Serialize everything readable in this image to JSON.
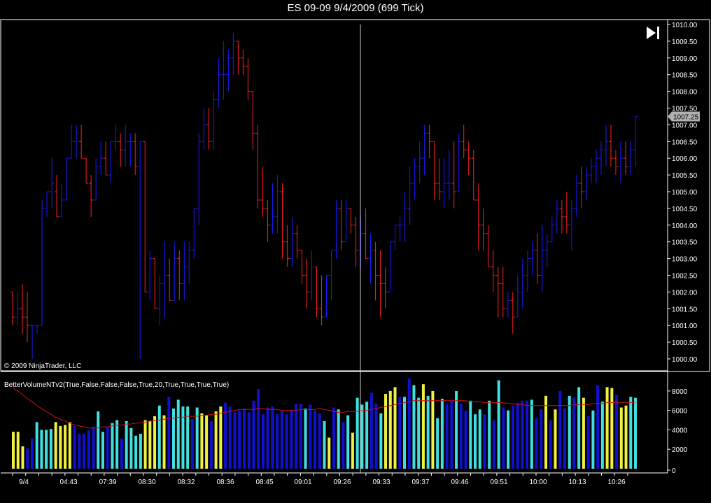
{
  "window": {
    "title": "ES 09-09  9/4/2009 (699 Tick)"
  },
  "price_panel": {
    "copyright": "© 2009 NinjaTrader, LLC",
    "last_price_label": "1007.25",
    "y_ticks": [
      "1010.00",
      "1009.50",
      "1009.00",
      "1008.50",
      "1008.00",
      "1007.50",
      "1007.00",
      "1006.50",
      "1006.00",
      "1005.50",
      "1005.00",
      "1004.50",
      "1004.00",
      "1003.50",
      "1003.00",
      "1002.50",
      "1002.00",
      "1001.50",
      "1001.00",
      "1000.50",
      "1000.00"
    ]
  },
  "volume_panel": {
    "indicator_label": "BetterVolumeNTv2(True,False,False,False,True,20,True,True,True,True)",
    "y_ticks": [
      "8000",
      "6000",
      "4000",
      "2000",
      "0"
    ]
  },
  "x_ticks": [
    "9/4",
    "04:43",
    "07:39",
    "08:30",
    "08:32",
    "08:36",
    "08:45",
    "09:01",
    "09:26",
    "09:33",
    "09:37",
    "09:46",
    "09:51",
    "10:00",
    "10:13",
    "10:26"
  ],
  "colors": {
    "up_bar": "#1a1aff",
    "down_bar": "#ff2020",
    "vol_blue": "#1010d0",
    "vol_cyan": "#40e0e0",
    "vol_yellow": "#f0f040",
    "avg_line": "#cc1111",
    "crosshair": "#cccccc",
    "last_price_bg": "#b0b0b0"
  },
  "chart_data": [
    {
      "type": "ohlc",
      "ylim": [
        999.8,
        1010.1
      ],
      "bars": [
        [
          1002.0,
          1002.0,
          1001.0,
          1001.25
        ],
        [
          1001.25,
          1002.0,
          1001.0,
          1001.5
        ],
        [
          1001.5,
          1002.25,
          1000.75,
          1001.25
        ],
        [
          1001.25,
          1002.0,
          1000.5,
          1001.0
        ],
        [
          1001.0,
          1001.0,
          1000.0,
          1001.0
        ],
        [
          1001.0,
          1001.0,
          1000.75,
          1001.0
        ],
        [
          1001.0,
          1004.75,
          1001.0,
          1004.5
        ],
        [
          1004.5,
          1005.0,
          1004.25,
          1005.0
        ],
        [
          1005.0,
          1006.0,
          1004.5,
          1005.25
        ],
        [
          1005.0,
          1005.5,
          1004.25,
          1004.25
        ],
        [
          1004.25,
          1005.25,
          1004.25,
          1004.75
        ],
        [
          1004.75,
          1006.0,
          1004.75,
          1006.0
        ],
        [
          1006.0,
          1007.0,
          1006.0,
          1006.5
        ],
        [
          1006.5,
          1007.0,
          1006.0,
          1006.75
        ],
        [
          1006.5,
          1007.0,
          1006.0,
          1006.0
        ],
        [
          1006.0,
          1006.0,
          1005.25,
          1005.25
        ],
        [
          1005.25,
          1005.5,
          1004.25,
          1004.75
        ],
        [
          1004.75,
          1006.0,
          1004.75,
          1005.75
        ],
        [
          1005.75,
          1006.5,
          1005.5,
          1006.0
        ],
        [
          1006.0,
          1006.5,
          1005.5,
          1005.5
        ],
        [
          1005.5,
          1006.5,
          1005.25,
          1006.5
        ],
        [
          1006.5,
          1007.0,
          1006.25,
          1006.5
        ],
        [
          1006.5,
          1006.75,
          1005.75,
          1006.25
        ],
        [
          1006.25,
          1007.0,
          1005.75,
          1006.5
        ],
        [
          1006.5,
          1006.75,
          1005.75,
          1006.5
        ],
        [
          1006.5,
          1006.75,
          1005.5,
          1005.75
        ],
        [
          1005.75,
          1006.5,
          1000.0,
          1006.5
        ],
        [
          1006.5,
          1006.5,
          1002.0,
          1002.0
        ],
        [
          1002.0,
          1003.25,
          1001.75,
          1003.0
        ],
        [
          1003.0,
          1003.0,
          1001.5,
          1001.5
        ],
        [
          1001.5,
          1002.5,
          1001.0,
          1002.25
        ],
        [
          1002.25,
          1003.5,
          1001.25,
          1002.5
        ],
        [
          1002.5,
          1003.0,
          1001.75,
          1001.75
        ],
        [
          1001.75,
          1003.5,
          1001.75,
          1003.0
        ],
        [
          1003.0,
          1003.25,
          1001.75,
          1002.25
        ],
        [
          1002.25,
          1003.5,
          1001.75,
          1002.75
        ],
        [
          1002.75,
          1003.5,
          1002.25,
          1003.25
        ],
        [
          1003.25,
          1004.5,
          1003.0,
          1004.5
        ],
        [
          1004.5,
          1006.75,
          1004.0,
          1006.5
        ],
        [
          1006.5,
          1007.5,
          1006.25,
          1007.0
        ],
        [
          1007.0,
          1007.5,
          1006.25,
          1006.5
        ],
        [
          1006.5,
          1008.0,
          1006.25,
          1007.75
        ],
        [
          1007.75,
          1009.0,
          1007.5,
          1008.5
        ],
        [
          1008.5,
          1009.5,
          1007.75,
          1008.5
        ],
        [
          1008.5,
          1009.25,
          1008.0,
          1009.0
        ],
        [
          1009.0,
          1009.75,
          1008.5,
          1009.5
        ],
        [
          1009.5,
          1009.5,
          1008.5,
          1009.0
        ],
        [
          1009.0,
          1009.25,
          1008.5,
          1008.75
        ],
        [
          1008.75,
          1009.0,
          1007.75,
          1008.0
        ],
        [
          1008.0,
          1008.0,
          1006.25,
          1006.75
        ],
        [
          1006.75,
          1007.0,
          1004.5,
          1004.75
        ],
        [
          1004.75,
          1005.75,
          1004.25,
          1004.5
        ],
        [
          1004.5,
          1004.75,
          1003.5,
          1004.0
        ],
        [
          1004.0,
          1005.25,
          1003.75,
          1004.25
        ],
        [
          1004.25,
          1005.5,
          1003.75,
          1005.0
        ],
        [
          1005.0,
          1005.25,
          1003.0,
          1003.5
        ],
        [
          1003.5,
          1004.0,
          1002.75,
          1003.0
        ],
        [
          1003.0,
          1004.25,
          1002.75,
          1003.75
        ],
        [
          1003.75,
          1004.0,
          1003.0,
          1003.25
        ],
        [
          1003.25,
          1003.25,
          1002.25,
          1002.5
        ],
        [
          1002.5,
          1003.0,
          1001.5,
          1002.0
        ],
        [
          1002.0,
          1003.25,
          1001.75,
          1002.75
        ],
        [
          1002.75,
          1002.75,
          1001.25,
          1001.5
        ],
        [
          1001.5,
          1002.5,
          1001.0,
          1001.25
        ],
        [
          1001.25,
          1002.5,
          1001.25,
          1002.5
        ],
        [
          1002.5,
          1003.25,
          1001.75,
          1003.25
        ],
        [
          1003.25,
          1004.75,
          1003.0,
          1004.5
        ],
        [
          1004.5,
          1004.75,
          1003.25,
          1003.5
        ],
        [
          1003.5,
          1004.75,
          1003.5,
          1004.5
        ],
        [
          1004.5,
          1004.5,
          1003.75,
          1004.0
        ],
        [
          1004.0,
          1004.25,
          1002.75,
          1003.25
        ],
        [
          1003.25,
          1004.25,
          1002.75,
          1003.75
        ],
        [
          1003.75,
          1004.5,
          1003.0,
          1003.0
        ],
        [
          1003.0,
          1003.75,
          1002.25,
          1003.25
        ],
        [
          1003.25,
          1003.5,
          1001.75,
          1002.5
        ],
        [
          1002.5,
          1003.25,
          1001.25,
          1002.25
        ],
        [
          1002.25,
          1002.75,
          1001.5,
          1002.0
        ],
        [
          1002.0,
          1003.5,
          1002.0,
          1003.5
        ],
        [
          1003.5,
          1004.0,
          1003.25,
          1004.0
        ],
        [
          1004.0,
          1004.25,
          1003.5,
          1004.0
        ],
        [
          1004.0,
          1005.0,
          1003.5,
          1004.5
        ],
        [
          1004.5,
          1005.75,
          1004.0,
          1005.25
        ],
        [
          1005.25,
          1006.0,
          1004.75,
          1005.75
        ],
        [
          1005.75,
          1006.5,
          1005.25,
          1006.0
        ],
        [
          1006.0,
          1007.0,
          1005.5,
          1006.75
        ],
        [
          1006.75,
          1007.0,
          1006.0,
          1006.5
        ],
        [
          1006.5,
          1006.5,
          1004.75,
          1005.25
        ],
        [
          1005.25,
          1006.0,
          1004.75,
          1005.0
        ],
        [
          1005.0,
          1006.0,
          1004.5,
          1005.25
        ],
        [
          1005.25,
          1006.25,
          1004.75,
          1005.25
        ],
        [
          1005.25,
          1006.5,
          1004.5,
          1005.0
        ],
        [
          1005.0,
          1006.75,
          1005.0,
          1006.5
        ],
        [
          1006.5,
          1007.0,
          1006.0,
          1006.25
        ],
        [
          1006.25,
          1006.5,
          1005.5,
          1006.0
        ],
        [
          1006.0,
          1006.25,
          1004.75,
          1004.75
        ],
        [
          1004.75,
          1005.25,
          1003.25,
          1004.0
        ],
        [
          1004.0,
          1004.5,
          1003.25,
          1003.75
        ],
        [
          1003.75,
          1004.0,
          1002.75,
          1002.75
        ],
        [
          1002.75,
          1003.25,
          1002.0,
          1002.5
        ],
        [
          1002.5,
          1002.75,
          1001.25,
          1002.25
        ],
        [
          1002.25,
          1002.75,
          1001.25,
          1001.5
        ],
        [
          1001.5,
          1002.0,
          1001.25,
          1001.75
        ],
        [
          1001.75,
          1002.0,
          1000.75,
          1001.25
        ],
        [
          1001.25,
          1002.5,
          1001.25,
          1002.0
        ],
        [
          1002.0,
          1003.0,
          1001.5,
          1002.5
        ],
        [
          1002.5,
          1003.25,
          1002.0,
          1003.0
        ],
        [
          1003.0,
          1003.5,
          1002.5,
          1003.25
        ],
        [
          1003.25,
          1003.75,
          1002.25,
          1002.5
        ],
        [
          1002.5,
          1004.0,
          1002.0,
          1003.25
        ],
        [
          1003.25,
          1003.75,
          1002.75,
          1003.5
        ],
        [
          1003.5,
          1004.25,
          1003.5,
          1004.0
        ],
        [
          1004.0,
          1004.75,
          1003.75,
          1004.5
        ],
        [
          1004.5,
          1004.75,
          1003.75,
          1004.25
        ],
        [
          1004.25,
          1005.0,
          1003.75,
          1004.0
        ],
        [
          1004.0,
          1004.75,
          1003.25,
          1004.5
        ],
        [
          1004.5,
          1005.5,
          1004.25,
          1005.25
        ],
        [
          1005.25,
          1005.75,
          1004.5,
          1005.0
        ],
        [
          1005.0,
          1005.75,
          1004.75,
          1005.5
        ],
        [
          1005.5,
          1006.0,
          1005.25,
          1005.75
        ],
        [
          1005.75,
          1006.25,
          1005.25,
          1006.0
        ],
        [
          1006.0,
          1006.5,
          1005.5,
          1006.25
        ],
        [
          1006.25,
          1007.0,
          1005.75,
          1006.5
        ],
        [
          1006.5,
          1007.0,
          1005.75,
          1006.0
        ],
        [
          1006.0,
          1006.25,
          1005.5,
          1005.75
        ],
        [
          1005.75,
          1006.5,
          1005.25,
          1006.0
        ],
        [
          1006.0,
          1006.5,
          1005.5,
          1005.75
        ],
        [
          1005.75,
          1006.5,
          1005.5,
          1006.25
        ],
        [
          1006.25,
          1007.25,
          1005.75,
          1007.25
        ]
      ]
    },
    {
      "type": "bar",
      "ylim": [
        0,
        9000
      ],
      "values": [
        3800,
        3800,
        2300,
        2100,
        3100,
        4800,
        4000,
        4000,
        4100,
        4800,
        4400,
        4500,
        4800,
        4400,
        3600,
        3600,
        4000,
        4300,
        5900,
        3800,
        4300,
        4700,
        5000,
        3100,
        4900,
        4200,
        3400,
        3600,
        5000,
        4900,
        5400,
        6500,
        5500,
        7400,
        6200,
        7100,
        6400,
        6400,
        5100,
        6300,
        5700,
        5500,
        4900,
        5900,
        6400,
        6800,
        6400,
        5800,
        6000,
        6200,
        5800,
        7000,
        8200,
        5600,
        6300,
        6400,
        5600,
        6000,
        5600,
        6100,
        6700,
        6700,
        6200,
        6600,
        6000,
        5700,
        4900,
        3200,
        6300,
        6100,
        4800,
        5500,
        3700,
        7300,
        6600,
        6900,
        7800,
        6700,
        5700,
        7700,
        8000,
        8400,
        7400,
        7400,
        9300,
        8600,
        7300,
        8700,
        7500,
        8000,
        5200,
        7200,
        6700,
        7000,
        8000,
        6700,
        6000,
        7000,
        5600,
        6100,
        5600,
        7000,
        5000,
        9100,
        6300,
        6000,
        6500,
        6800,
        7000,
        7000,
        7100,
        5200,
        6100,
        7500,
        5000,
        6100,
        8000,
        6200,
        7500,
        7300,
        8400,
        7300,
        5400,
        6000,
        8600,
        6900,
        8400,
        8300,
        7600,
        6300,
        6500,
        7400,
        7300
      ],
      "colors": [
        "yellow",
        "yellow",
        "yellow",
        "blue",
        "blue",
        "cyan",
        "cyan",
        "cyan",
        "cyan",
        "yellow",
        "yellow",
        "yellow",
        "yellow",
        "blue",
        "blue",
        "blue",
        "blue",
        "blue",
        "cyan",
        "cyan",
        "blue",
        "cyan",
        "cyan",
        "blue",
        "cyan",
        "cyan",
        "cyan",
        "cyan",
        "yellow",
        "yellow",
        "yellow",
        "cyan",
        "yellow",
        "blue",
        "cyan",
        "cyan",
        "cyan",
        "cyan",
        "blue",
        "cyan",
        "yellow",
        "yellow",
        "blue",
        "yellow",
        "yellow",
        "blue",
        "blue",
        "blue",
        "blue",
        "blue",
        "blue",
        "blue",
        "blue",
        "blue",
        "blue",
        "blue",
        "blue",
        "blue",
        "blue",
        "blue",
        "blue",
        "blue",
        "cyan",
        "blue",
        "blue",
        "blue",
        "cyan",
        "yellow",
        "blue",
        "cyan",
        "blue",
        "cyan",
        "yellow",
        "cyan",
        "cyan",
        "cyan",
        "blue",
        "blue",
        "cyan",
        "yellow",
        "yellow",
        "yellow",
        "blue",
        "cyan",
        "blue",
        "cyan",
        "cyan",
        "yellow",
        "cyan",
        "yellow",
        "cyan",
        "cyan",
        "blue",
        "blue",
        "cyan",
        "blue",
        "blue",
        "cyan",
        "cyan",
        "cyan",
        "blue",
        "cyan",
        "blue",
        "cyan",
        "blue",
        "cyan",
        "blue",
        "blue",
        "blue",
        "blue",
        "cyan",
        "blue",
        "blue",
        "yellow",
        "blue",
        "yellow",
        "blue",
        "blue",
        "cyan",
        "blue",
        "cyan",
        "yellow",
        "blue",
        "cyan",
        "blue",
        "cyan",
        "yellow",
        "yellow",
        "blue",
        "yellow",
        "yellow",
        "cyan",
        "cyan"
      ],
      "average": [
        8300,
        8000,
        7600,
        7200,
        6900,
        6500,
        6200,
        5900,
        5600,
        5300,
        5100,
        4900,
        4700,
        4500,
        4400,
        4300,
        4200,
        4200,
        4200,
        4300,
        4300,
        4400,
        4500,
        4500,
        4600,
        4600,
        4700,
        4700,
        4800,
        4900,
        5000,
        5000,
        5100,
        5200,
        5200,
        5300,
        5300,
        5400,
        5400,
        5400,
        5500,
        5500,
        5600,
        5600,
        5700,
        5800,
        5900,
        6000,
        6100,
        6100,
        6100,
        6100,
        6200,
        6200,
        6100,
        6100,
        6100,
        6000,
        6000,
        6000,
        6000,
        6100,
        6100,
        6100,
        6100,
        6200,
        6100,
        6000,
        5900,
        5800,
        5800,
        5900,
        5900,
        5900,
        6000,
        6000,
        6100,
        6200,
        6300,
        6400,
        6500,
        6600,
        6700,
        6800,
        6900,
        7000,
        7000,
        7000,
        7000,
        7000,
        7000,
        7000,
        7000,
        7000,
        7000,
        7000,
        7000,
        6900,
        6900,
        6900,
        6800,
        6800,
        6800,
        6800,
        6800,
        6700,
        6700,
        6600,
        6600,
        6500,
        6500,
        6500,
        6500,
        6500,
        6500,
        6500,
        6500,
        6500,
        6500,
        6600,
        6600,
        6600,
        6600,
        6700,
        6700,
        6700,
        6800,
        6800,
        6800,
        6800,
        6800,
        6800,
        6800
      ]
    }
  ]
}
